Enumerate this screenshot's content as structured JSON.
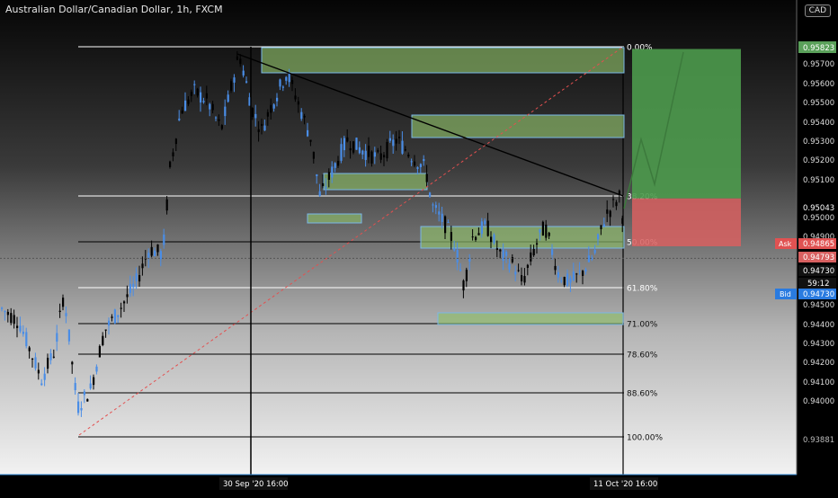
{
  "header": {
    "title": "Australian Dollar/Canadian Dollar, 1h, FXCM",
    "currency": "CAD"
  },
  "price_scale": {
    "labels": [
      "0.95823",
      "0.95700",
      "0.95600",
      "0.95500",
      "0.95400",
      "0.95300",
      "0.95200",
      "0.95100",
      "0.95043",
      "0.95000",
      "0.94900",
      "0.94865",
      "0.94793",
      "0.94730",
      "59:12",
      "0.94730",
      "0.94500",
      "0.94400",
      "0.94300",
      "0.94200",
      "0.94100",
      "0.94000",
      "0.93881"
    ],
    "ask_label": "Ask",
    "ask_value": "0.94865",
    "bid_label": "Bid",
    "bid_value": "0.94730",
    "last_value": "0.94730",
    "countdown": "59:12",
    "target_value": "0.95823",
    "stop_value": "0.94793",
    "level_value": "0.95043"
  },
  "time_axis": {
    "labels": [
      "30 Sep '20   16:00",
      "11 Oct '20   16:00"
    ]
  },
  "fib_levels": [
    "0.00%",
    "38.20%",
    "50.00%",
    "61.80%",
    "71.00%",
    "78.60%",
    "88.60%",
    "100.00%"
  ],
  "colors": {
    "bullish": "#4a8de6",
    "bearish": "#000000",
    "zone_fill": "#8fbf6a",
    "zone_stroke": "#7ab8e8",
    "profit": "#4c9a4c",
    "loss": "#d86060",
    "ask": "#e05252",
    "bid": "#2a7be0"
  },
  "chart_data": {
    "type": "candlestick",
    "symbol": "AUDCAD",
    "timeframe": "1h",
    "ylim": [
      0.937,
      0.96
    ],
    "fibonacci": {
      "high": 0.95823,
      "low": 0.93881,
      "levels": [
        {
          "label": "0.00%",
          "price": 0.95823
        },
        {
          "label": "38.20%",
          "price": 0.9508
        },
        {
          "label": "50.00%",
          "price": 0.94855
        },
        {
          "label": "61.80%",
          "price": 0.94625
        },
        {
          "label": "71.00%",
          "price": 0.9446
        },
        {
          "label": "78.60%",
          "price": 0.943
        },
        {
          "label": "88.60%",
          "price": 0.9411
        },
        {
          "label": "100.00%",
          "price": 0.93881
        }
      ]
    },
    "long_position": {
      "entry": 0.95043,
      "target": 0.95823,
      "stop": 0.94793
    },
    "current_price": 0.9473,
    "ask": 0.94865,
    "bid": 0.9473
  }
}
